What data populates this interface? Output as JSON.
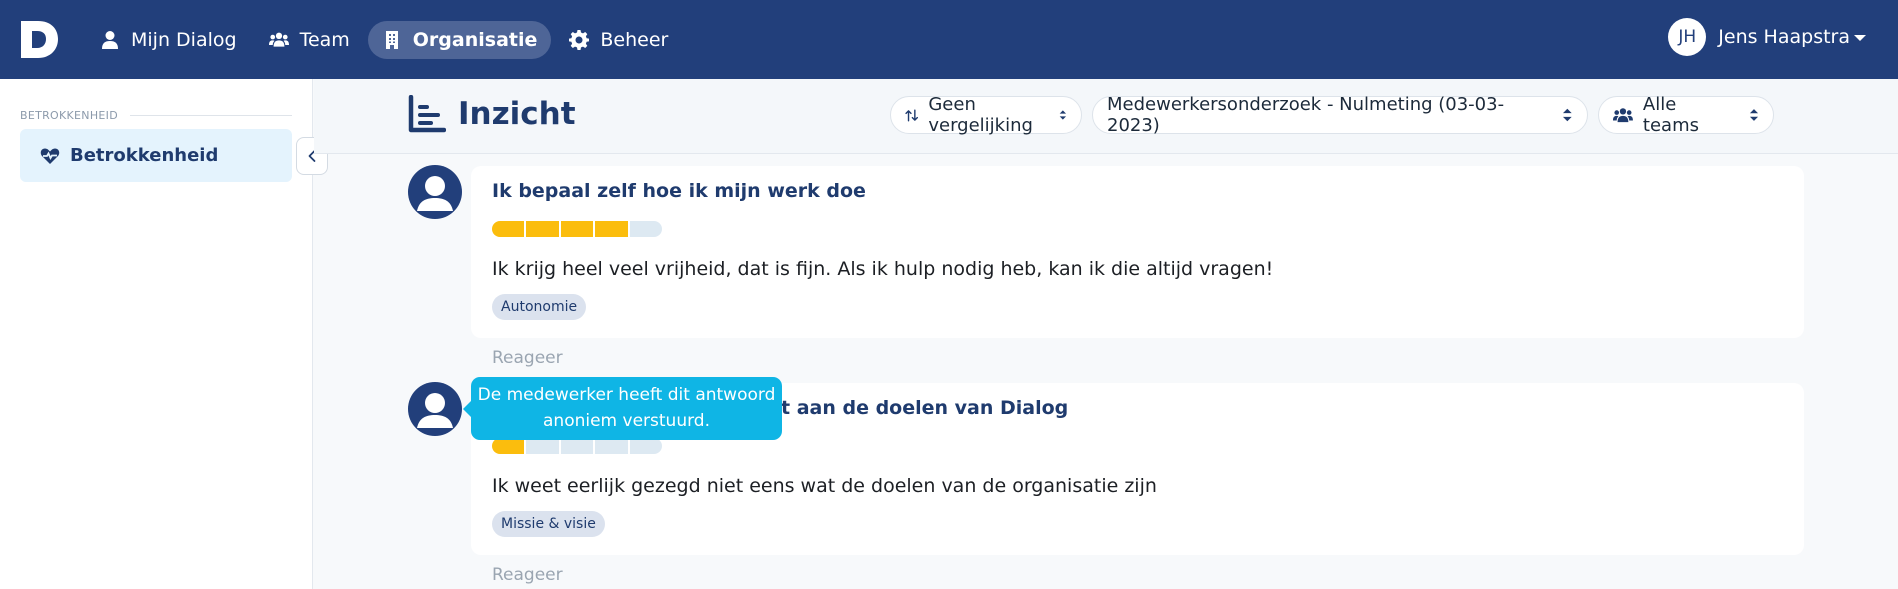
{
  "nav": {
    "logo_letter": "D",
    "items": [
      {
        "label": "Mijn Dialog",
        "icon": "user-icon",
        "active": false
      },
      {
        "label": "Team",
        "icon": "users-icon",
        "active": false
      },
      {
        "label": "Organisatie",
        "icon": "building-icon",
        "active": true
      },
      {
        "label": "Beheer",
        "icon": "gear-icon",
        "active": false
      }
    ],
    "user": {
      "initials": "JH",
      "name": "Jens Haapstra"
    }
  },
  "sidebar": {
    "section_label": "BETROKKENHEID",
    "items": [
      {
        "label": "Betrokkenheid",
        "icon": "heartbeat-icon",
        "active": true
      }
    ]
  },
  "header": {
    "title": "Inzicht",
    "filters": [
      {
        "value": "Geen vergelijking",
        "icon": "sort-arrows-icon"
      },
      {
        "value": "Medewerkersonderzoek - Nulmeting (03-03-2023)",
        "icon": "none"
      },
      {
        "value": "Alle teams",
        "icon": "users-icon"
      }
    ]
  },
  "responses": [
    {
      "question": "Ik bepaal zelf hoe ik mijn werk doe",
      "score": 4,
      "max_score": 5,
      "answer": "Ik krijg heel veel vrijheid, dat is fijn. Als ik hulp nodig heb, kan ik die altijd vragen!",
      "tag": "Autonomie",
      "reply_label": "Reageer"
    },
    {
      "question": "Ik lever een bijdrage aan de doelen van Dialog",
      "question_visible": "t aan de doelen van Dialog",
      "score": 1,
      "max_score": 5,
      "answer": "Ik weet eerlijk gezegd niet eens wat de doelen van de organisatie zijn",
      "tag": "Missie & visie",
      "reply_label": "Reageer"
    }
  ],
  "tooltip": {
    "line1": "De medewerker heeft dit antwoord",
    "line2": "anoniem verstuurd."
  },
  "colors": {
    "nav_bg": "#223f7b",
    "accent_yellow": "#fbbd0d",
    "tooltip_bg": "#0fb5e5",
    "sidebar_active_bg": "#e4f3fd"
  }
}
